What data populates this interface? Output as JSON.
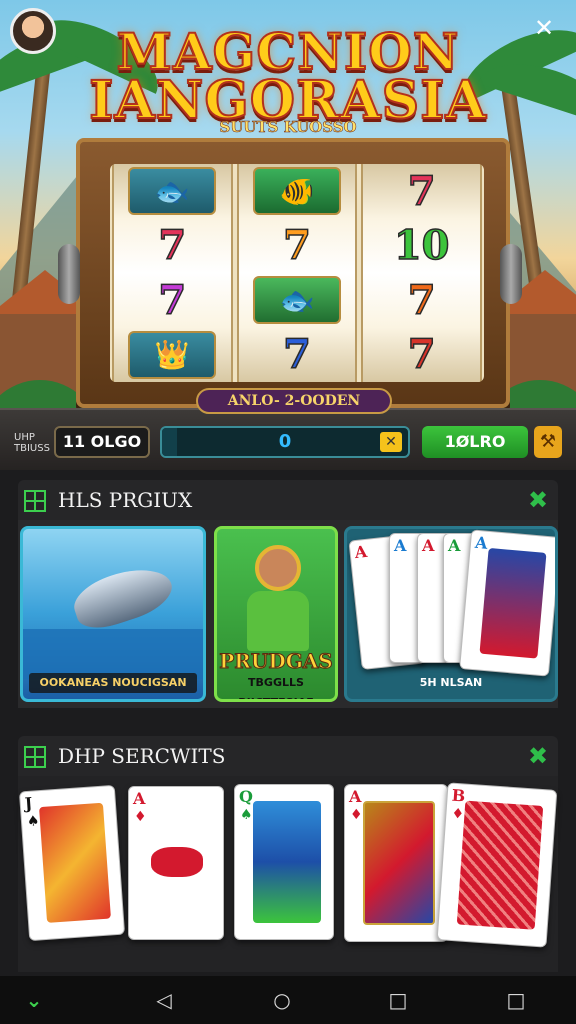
{
  "hero": {
    "title_line1": "MAGCNION",
    "title_line2": "IANGORASIA",
    "subtitle": "SUUTS KUOSSO",
    "win_banner": "ANLO- 2-OODEN",
    "bet_label": "UHP TBIUSS",
    "credit": "11 OLGO",
    "progress": {
      "value": "0",
      "fill_fraction": 0.06
    },
    "spin_value": "1ØLRO",
    "reels": [
      [
        "fish-tile",
        "7",
        "7",
        "crown-tile"
      ],
      [
        "fish-tile",
        "7",
        "fish-tile",
        "7"
      ],
      [
        "7",
        "10",
        "7",
        "7"
      ]
    ],
    "colors": {
      "title": "#ffcc1a",
      "title_stroke": "#b3311c",
      "spin": "#2fa62f",
      "accent_green": "#3ccf4e"
    }
  },
  "section1": {
    "title": "HLS PRGIUX",
    "cards": [
      {
        "name": "fishing-game",
        "label": "OOKANEAS NOUCIGSAN",
        "big": ""
      },
      {
        "name": "farmer-game",
        "label": "TBGGLLS BIJCTTFSIAE",
        "big": "PRUDGAS"
      },
      {
        "name": "card-spread-game",
        "label": "5H NLSAN",
        "big": ""
      }
    ]
  },
  "section2": {
    "title": "DHP SERCWITS",
    "cards": [
      {
        "rank": "J",
        "suit": "♠",
        "color": "#111"
      },
      {
        "rank": "A",
        "suit": "♦",
        "color": "#d3192e"
      },
      {
        "rank": "Q",
        "suit": "♠",
        "color": "#1a9c3a"
      },
      {
        "rank": "A",
        "suit": "♦",
        "color": "#d3192e"
      },
      {
        "rank": "B",
        "suit": "♦",
        "color": "#d3192e"
      }
    ]
  },
  "navbar": {
    "icons": [
      "chevron-down-icon",
      "back-icon",
      "home-icon",
      "recents-icon",
      "square-icon"
    ]
  }
}
